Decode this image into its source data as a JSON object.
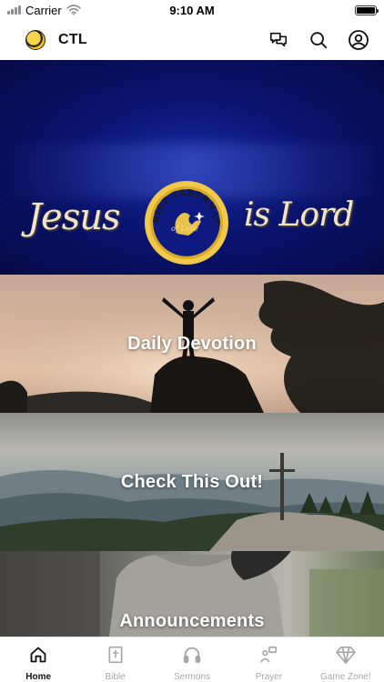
{
  "status_bar": {
    "carrier": "Carrier",
    "time": "9:10 AM"
  },
  "header": {
    "title": "CTL",
    "icons": [
      "chat-icon",
      "search-icon",
      "profile-icon"
    ]
  },
  "hero": {
    "left_text": "Jesus",
    "right_text": "is Lord",
    "seal_ring_text": "CHRIST TABERNACLE",
    "seal_inner_text": "of Love"
  },
  "tiles": [
    {
      "label": "Daily Devotion"
    },
    {
      "label": "Check This Out!"
    },
    {
      "label": "Announcements"
    }
  ],
  "tabs": [
    {
      "label": "Home",
      "icon": "home-icon",
      "active": true
    },
    {
      "label": "Bible",
      "icon": "bible-icon",
      "active": false
    },
    {
      "label": "Sermons",
      "icon": "headphones-icon",
      "active": false
    },
    {
      "label": "Prayer",
      "icon": "prayer-icon",
      "active": false
    },
    {
      "label": "Game Zone!",
      "icon": "diamond-icon",
      "active": false
    }
  ],
  "colors": {
    "accent": "#111111",
    "inactive": "#a7a7a7",
    "hero_blue": "#0a1470",
    "seal_gold": "#f0c94a"
  }
}
